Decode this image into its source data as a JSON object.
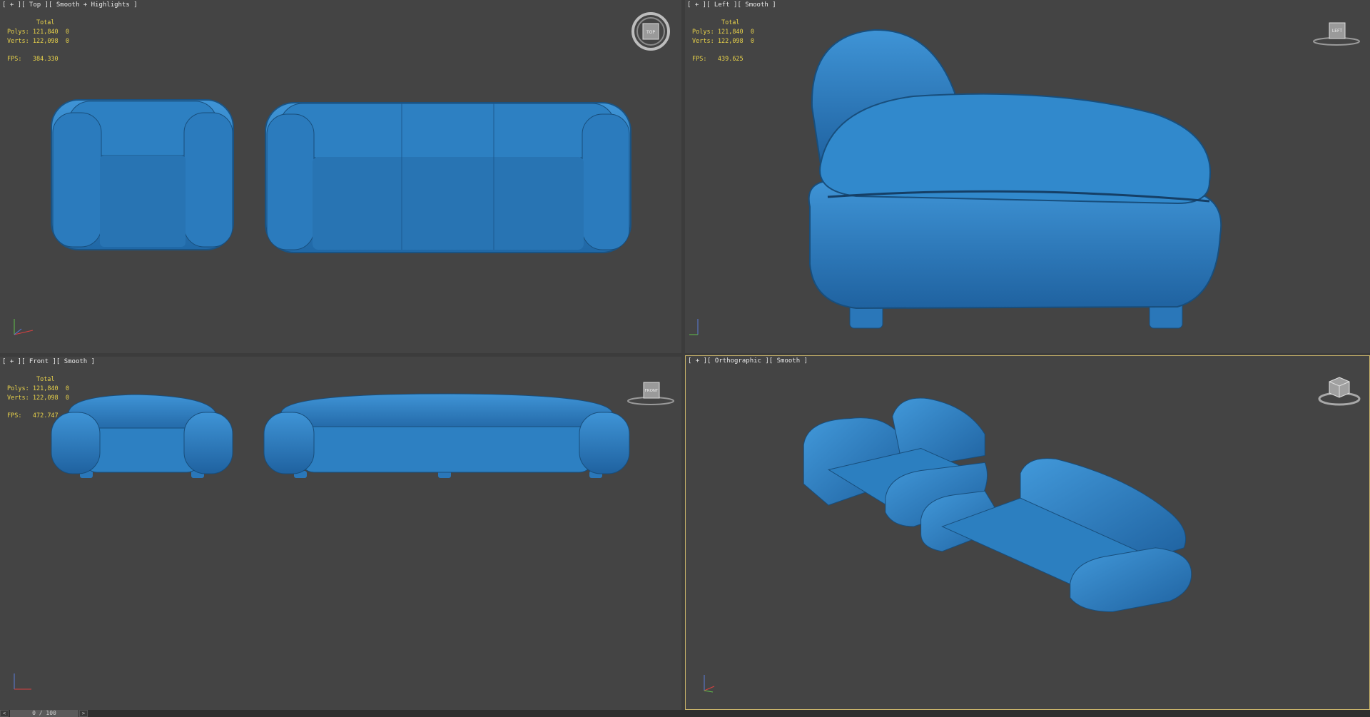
{
  "viewports": [
    {
      "id": "top",
      "label": "[ + ][ Top ][ Smooth + Highlights ]",
      "stats": {
        "total_label": "Total",
        "polys_label": "Polys:",
        "polys_value": "121,840",
        "polys_sel": "0",
        "verts_label": "Verts:",
        "verts_value": "122,098",
        "verts_sel": "0",
        "fps_label": "FPS:",
        "fps_value": "384.330"
      },
      "cube_label": "TOP"
    },
    {
      "id": "left",
      "label": "[ + ][ Left ][ Smooth ]",
      "stats": {
        "total_label": "Total",
        "polys_label": "Polys:",
        "polys_value": "121,840",
        "polys_sel": "0",
        "verts_label": "Verts:",
        "verts_value": "122,098",
        "verts_sel": "0",
        "fps_label": "FPS:",
        "fps_value": "439.625"
      },
      "cube_label": "LEFT"
    },
    {
      "id": "front",
      "label": "[ + ][ Front ][ Smooth ]",
      "stats": {
        "total_label": "Total",
        "polys_label": "Polys:",
        "polys_value": "121,840",
        "polys_sel": "0",
        "verts_label": "Verts:",
        "verts_value": "122,098",
        "verts_sel": "0",
        "fps_label": "FPS:",
        "fps_value": "472.747"
      },
      "cube_label": "FRONT"
    },
    {
      "id": "ortho",
      "label": "[ + ][ Orthographic ][ Smooth ]",
      "cube_label": ""
    }
  ],
  "timeline": {
    "value": "0 / 100",
    "prev": "<",
    "next": ">"
  },
  "colors": {
    "viewport_bg": "#444444",
    "model": "#2e7fc0",
    "model_shade": "#1f5f96",
    "active_border": "#c9b36a",
    "stats_text": "#e8d24a"
  }
}
